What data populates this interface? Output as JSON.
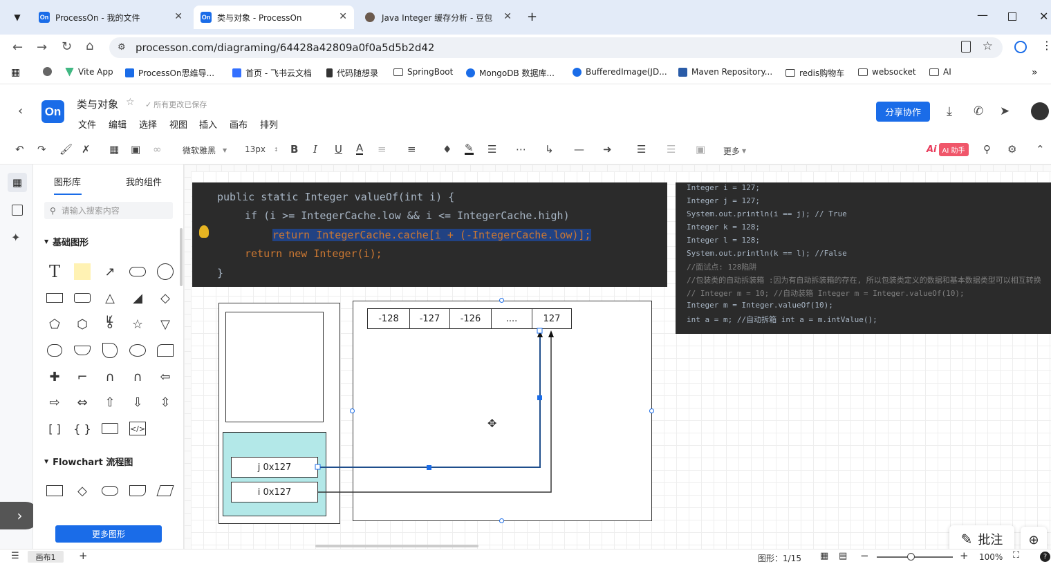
{
  "browser": {
    "tabs": [
      {
        "title": "ProcessOn - 我的文件",
        "favicon": "On"
      },
      {
        "title": "类与对象 - ProcessOn",
        "favicon": "On"
      },
      {
        "title": "Java Integer 缓存分析 - 豆包",
        "favicon": "doubao"
      }
    ],
    "url": "processon.com/diagraming/64428a42809a0f0a5d5b2d42",
    "bookmarks": [
      "Vite App",
      "ProcessOn思维导...",
      "首页 - 飞书云文档",
      "代码随想录",
      "SpringBoot",
      "MongoDB 数据库...",
      "BufferedImage(JD...",
      "Maven Repository...",
      "redis购物车",
      "websocket",
      "AI"
    ]
  },
  "app": {
    "logo": "On",
    "title": "类与对象",
    "save_status": "所有更改已保存",
    "menus": [
      "文件",
      "编辑",
      "选择",
      "视图",
      "插入",
      "画布",
      "排列"
    ],
    "share_label": "分享协作",
    "font_family": "微软雅黑",
    "font_size": "13px",
    "more_label": "更多",
    "ai_label": "AI 助手"
  },
  "panel": {
    "tabs": [
      "图形库",
      "我的组件"
    ],
    "search_placeholder": "请输入搜索内容",
    "section_basic": "基础图形",
    "section_flowchart": "Flowchart 流程图",
    "more_shapes": "更多图形"
  },
  "code1": {
    "lines": [
      "public static Integer valueOf(int i) {",
      "if (i >= IntegerCache.low && i <= IntegerCache.high)",
      "return IntegerCache.cache[i + (-IntegerCache.low)];",
      "return new Integer(i);",
      "}"
    ]
  },
  "code2": {
    "lines": [
      "Integer i = 127;",
      "Integer j = 127;",
      "System.out.println(i == j); // True",
      "Integer k = 128;",
      "Integer l = 128;",
      "System.out.println(k == l); //False",
      "//面试点: 128陷阱",
      "//包装类的自动拆装箱 :因为有自动拆装箱的存在, 所以包装类定义的数据和基本数据类型可以相互转换",
      "// Integer m = 10; //自动装箱 Integer m = Integer.valueOf(10);",
      "Integer m = Integer.valueOf(10);",
      "int a = m; //自动拆箱 int a = m.intValue();"
    ]
  },
  "diagram": {
    "cache_cells": [
      "-128",
      "-127",
      "-126",
      "....",
      "127"
    ],
    "stack_vars": [
      "j  0x127",
      "i   0x127"
    ]
  },
  "status": {
    "canvas_tab": "画布1",
    "shape_count": "图形：1/15",
    "zoom": "100%",
    "annotate_label": "批注"
  },
  "colors": {
    "accent": "#1a6ce8",
    "code_bg": "#2b2b2b",
    "stack_fill": "#b3e8e8"
  }
}
